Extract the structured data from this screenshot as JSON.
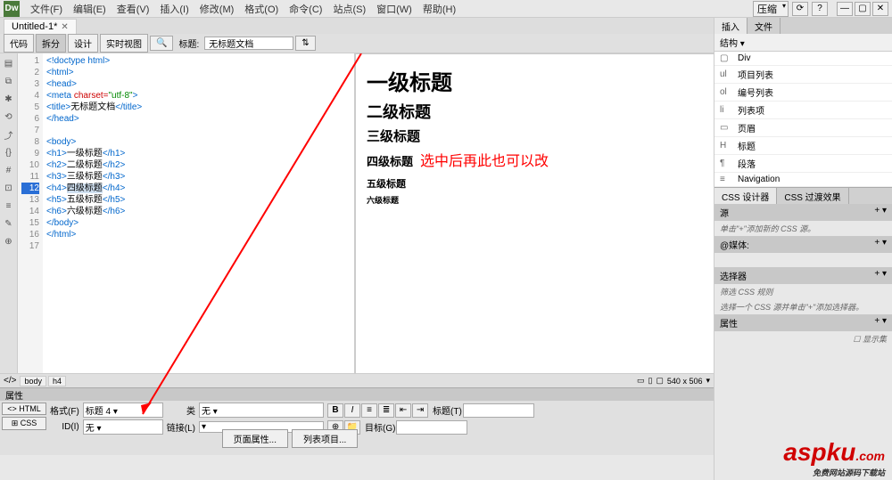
{
  "app": {
    "logo": "Dw"
  },
  "menu": [
    "文件(F)",
    "编辑(E)",
    "查看(V)",
    "插入(I)",
    "修改(M)",
    "格式(O)",
    "命令(C)",
    "站点(S)",
    "窗口(W)",
    "帮助(H)"
  ],
  "layout_dropdown": "压缩",
  "doc_tab": "Untitled-1*",
  "view_buttons": {
    "code": "代码",
    "split": "拆分",
    "design": "设计",
    "live": "实时视图"
  },
  "title_label": "标题:",
  "title_value": "无标题文档",
  "code_lines": [
    {
      "n": 1,
      "html": "<span class='tag'>&lt;!doctype html&gt;</span>"
    },
    {
      "n": 2,
      "html": "<span class='tag'>&lt;html&gt;</span>"
    },
    {
      "n": 3,
      "html": "<span class='tag'>&lt;head&gt;</span>"
    },
    {
      "n": 4,
      "html": "<span class='tag'>&lt;meta</span> <span class='attr'>charset=</span><span class='str'>\"utf-8\"</span><span class='tag'>&gt;</span>"
    },
    {
      "n": 5,
      "html": "<span class='tag'>&lt;title&gt;</span><span class='txt'>无标题文档</span><span class='tag'>&lt;/title&gt;</span>"
    },
    {
      "n": 6,
      "html": "<span class='tag'>&lt;/head&gt;</span>"
    },
    {
      "n": 7,
      "html": ""
    },
    {
      "n": 8,
      "html": "<span class='tag'>&lt;body&gt;</span>"
    },
    {
      "n": 9,
      "html": "<span class='tag'>&lt;h1&gt;</span><span class='txt'>一级标题</span><span class='tag'>&lt;/h1&gt;</span>"
    },
    {
      "n": 10,
      "html": "<span class='tag'>&lt;h2&gt;</span><span class='txt'>二级标题</span><span class='tag'>&lt;/h2&gt;</span>"
    },
    {
      "n": 11,
      "html": "<span class='tag'>&lt;h3&gt;</span><span class='txt'>三级标题</span><span class='tag'>&lt;/h3&gt;</span>"
    },
    {
      "n": 12,
      "html": "<span class='tag'>&lt;h4&gt;</span><span class='sel txt'>四级标题</span><span class='tag'>&lt;/h4&gt;</span>",
      "hl": true
    },
    {
      "n": 13,
      "html": "<span class='tag'>&lt;h5&gt;</span><span class='txt'>五级标题</span><span class='tag'>&lt;/h5&gt;</span>"
    },
    {
      "n": 14,
      "html": "<span class='tag'>&lt;h6&gt;</span><span class='txt'>六级标题</span><span class='tag'>&lt;/h6&gt;</span>"
    },
    {
      "n": 15,
      "html": "<span class='tag'>&lt;/body&gt;</span>"
    },
    {
      "n": 16,
      "html": "<span class='tag'>&lt;/html&gt;</span>"
    },
    {
      "n": 17,
      "html": ""
    }
  ],
  "preview": {
    "h1": "一级标题",
    "h2": "二级标题",
    "h3": "三级标题",
    "h4": "四级标题",
    "h5": "五级标题",
    "h6": "六级标题"
  },
  "annotation": "选中后再此也可以改",
  "breadcrumb": [
    "body",
    "h4"
  ],
  "status_size": "540 x 506",
  "right": {
    "tabs": [
      "插入",
      "文件"
    ],
    "category": "结构",
    "items": [
      {
        "icon": "▢",
        "label": "Div"
      },
      {
        "icon": "ul",
        "label": "项目列表"
      },
      {
        "icon": "ol",
        "label": "编号列表"
      },
      {
        "icon": "li",
        "label": "列表项"
      },
      {
        "icon": "▭",
        "label": "页眉"
      },
      {
        "icon": "H",
        "label": "标题"
      },
      {
        "icon": "¶",
        "label": "段落"
      },
      {
        "icon": "≡",
        "label": "Navigation"
      }
    ],
    "css_tabs": [
      "CSS 设计器",
      "CSS 过渡效果"
    ],
    "source_hdr": "源",
    "source_hint": "单击\"+\"添加新的 CSS 源。",
    "media_hdr": "@媒体:",
    "selector_hdr": "选择器",
    "selector_hint": "筛选 CSS 规则",
    "selector_hint2": "选择一个 CSS 源并单击\"+\"添加选择器。",
    "props_hdr": "属性",
    "show_set": "显示集"
  },
  "props": {
    "title": "属性",
    "html_btn": "<> HTML",
    "css_btn": "⊞ CSS",
    "format_lbl": "格式(F)",
    "format_val": "标题 4",
    "id_lbl": "ID(I)",
    "id_val": "无",
    "class_lbl": "类",
    "class_val": "无",
    "link_lbl": "链接(L)",
    "link_val": "",
    "title_lbl": "标题(T)",
    "title_val": "",
    "target_lbl": "目标(G)",
    "target_val": "",
    "page_props": "页面属性...",
    "list_item": "列表项目..."
  },
  "watermark": {
    "main": "aspku",
    "com": ".com",
    "sub": "免费网站源码下载站"
  }
}
